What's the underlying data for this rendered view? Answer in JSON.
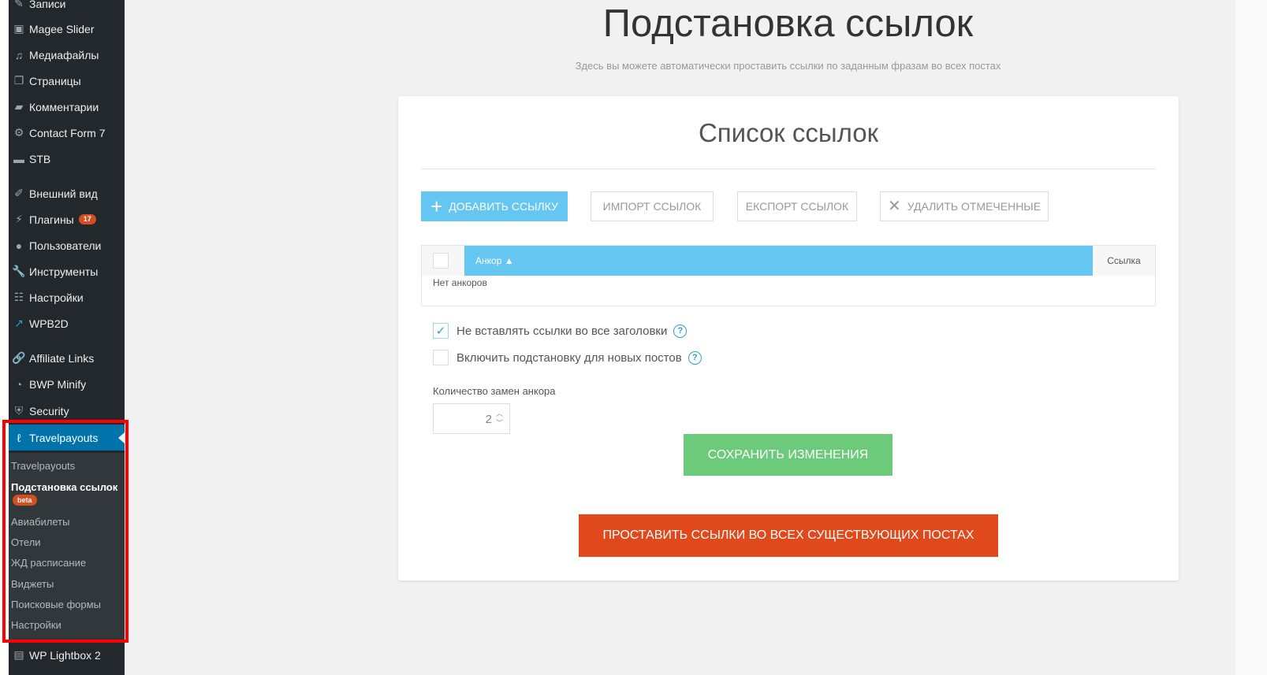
{
  "sidebar": {
    "items": [
      {
        "label": "Записи",
        "icon": "pin-icon"
      },
      {
        "label": "Magee Slider",
        "icon": "slider-icon"
      },
      {
        "label": "Медиафайлы",
        "icon": "media-icon"
      },
      {
        "label": "Страницы",
        "icon": "pages-icon"
      },
      {
        "label": "Комментарии",
        "icon": "comment-icon"
      },
      {
        "label": "Contact Form 7",
        "icon": "gear-icon"
      },
      {
        "label": "STB",
        "icon": "stb-icon"
      },
      {
        "label": "Внешний вид",
        "icon": "brush-icon"
      },
      {
        "label": "Плагины",
        "icon": "plugin-icon",
        "badge": "17"
      },
      {
        "label": "Пользователи",
        "icon": "user-icon"
      },
      {
        "label": "Инструменты",
        "icon": "wrench-icon"
      },
      {
        "label": "Настройки",
        "icon": "settings-icon"
      },
      {
        "label": "WPB2D",
        "icon": "wpb2d-icon"
      },
      {
        "label": "Affiliate Links",
        "icon": "link-icon"
      },
      {
        "label": "BWP Minify",
        "icon": "dashboard-icon"
      },
      {
        "label": "Security",
        "icon": "shield-icon"
      },
      {
        "label": "Travelpayouts",
        "icon": "travelpayouts-icon"
      },
      {
        "label": "WP Lightbox 2",
        "icon": "lightbox-icon"
      }
    ],
    "submenu": [
      "Travelpayouts",
      "Подстановка ссылок",
      "Авиабилеты",
      "Отели",
      "ЖД расписание",
      "Виджеты",
      "Поисковые формы",
      "Настройки"
    ],
    "beta_label": "beta"
  },
  "header": {
    "title": "Подстановка ссылок",
    "subtitle": "Здесь вы можете автоматически проставить ссылки по заданным фразам во всех постах"
  },
  "card": {
    "title": "Список ссылок",
    "buttons": {
      "add": "ДОБАВИТЬ ССЫЛКУ",
      "import": "ИМПОРТ ССЫЛОК",
      "export": "ЕКСПОРТ ССЫЛОК",
      "delete": "УДАЛИТЬ ОТМЕЧЕННЫЕ"
    },
    "table": {
      "col_anchor": "Анкор ▲",
      "col_link": "Ссылка",
      "empty": "Нет анкоров"
    },
    "options": {
      "no_headers": "Не вставлять ссылки во все заголовки",
      "new_posts": "Включить подстановку для новых постов"
    },
    "count_label": "Количество замен анкора",
    "count_value": "2",
    "save": "СОХРАНИТЬ ИЗМЕНЕНИЯ",
    "apply": "ПРОСТАВИТЬ ССЫЛКИ ВО ВСЕХ СУЩЕСТВУЮЩИХ ПОСТАХ"
  },
  "colors": {
    "sidebar_bg": "#23282d",
    "accent_blue": "#65c6f2",
    "save_green": "#6bcb7a",
    "apply_orange": "#e0491b",
    "highlight_red": "#ff0000"
  }
}
